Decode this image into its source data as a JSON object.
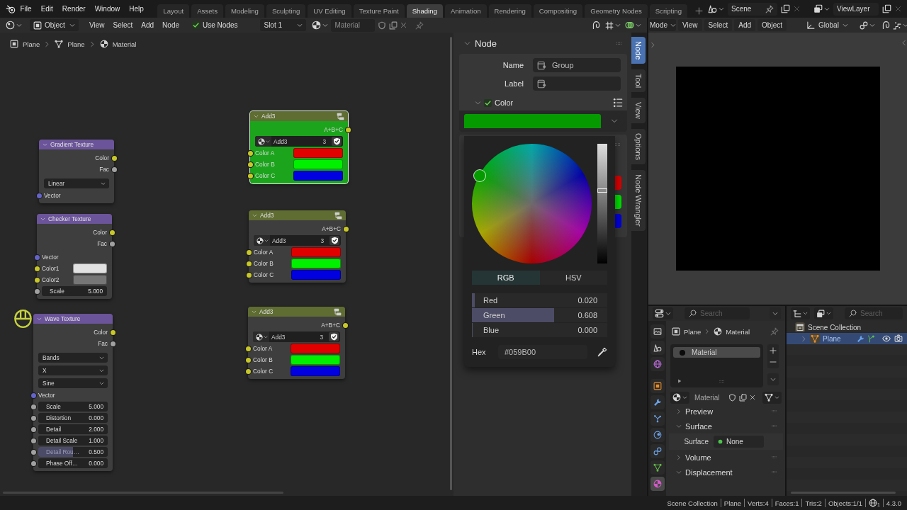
{
  "top_bar": {
    "menus": [
      "File",
      "Edit",
      "Render",
      "Window",
      "Help"
    ],
    "workspaces": [
      {
        "label": "Layout",
        "selected": false
      },
      {
        "label": "Assets",
        "selected": false
      },
      {
        "label": "Modeling",
        "selected": false
      },
      {
        "label": "Sculpting",
        "selected": false
      },
      {
        "label": "UV Editing",
        "selected": false
      },
      {
        "label": "Texture Paint",
        "selected": false
      },
      {
        "label": "Shading",
        "selected": true
      },
      {
        "label": "Animation",
        "selected": false
      },
      {
        "label": "Rendering",
        "selected": false
      },
      {
        "label": "Compositing",
        "selected": false
      },
      {
        "label": "Geometry Nodes",
        "selected": false
      },
      {
        "label": "Scripting",
        "selected": false
      }
    ],
    "scene": "Scene",
    "view_layer": "ViewLayer"
  },
  "node_editor": {
    "header": {
      "shader_type": "Object",
      "menus": [
        "View",
        "Select",
        "Add",
        "Node"
      ],
      "use_nodes": {
        "label": "Use Nodes",
        "checked": true
      },
      "slot": "Slot 1",
      "material": "Material"
    },
    "breadcrumb": [
      {
        "kind": "object",
        "label": "Plane"
      },
      {
        "kind": "mesh",
        "label": "Plane"
      },
      {
        "kind": "material",
        "label": "Material"
      }
    ],
    "nodes": [
      {
        "kind": "texture",
        "title": "Gradient Texture",
        "selected": false,
        "rows": [
          {
            "kind": "output",
            "label": "Color",
            "socket": {
              "kind": "color"
            }
          },
          {
            "kind": "output",
            "label": "Fac",
            "socket": {
              "kind": "float"
            }
          },
          {
            "kind": "menu",
            "value": "Linear"
          },
          {
            "kind": "input",
            "label": "Vector",
            "socket": {
              "kind": "vector"
            }
          }
        ]
      },
      {
        "kind": "texture",
        "title": "Checker Texture",
        "selected": false,
        "rows": [
          {
            "kind": "output",
            "label": "Color",
            "socket": {
              "kind": "color"
            }
          },
          {
            "kind": "output",
            "label": "Fac",
            "socket": {
              "kind": "float"
            }
          },
          {
            "kind": "input",
            "label": "Vector",
            "socket": {
              "kind": "vector"
            }
          },
          {
            "kind": "color",
            "label": "Color1",
            "socket": {
              "kind": "color"
            },
            "color": "#e2e2e2"
          },
          {
            "kind": "color",
            "label": "Color2",
            "socket": {
              "kind": "color"
            },
            "color": "#767676"
          },
          {
            "kind": "number",
            "label": "Scale",
            "value": "5.000",
            "socket": {
              "kind": "float"
            }
          }
        ]
      },
      {
        "kind": "texture",
        "title": "Wave Texture",
        "selected": false,
        "rows": [
          {
            "kind": "output",
            "label": "Color",
            "socket": {
              "kind": "color"
            }
          },
          {
            "kind": "output",
            "label": "Fac",
            "socket": {
              "kind": "float"
            }
          },
          {
            "kind": "menu",
            "value": "Bands"
          },
          {
            "kind": "menu",
            "value": "X"
          },
          {
            "kind": "menu",
            "value": "Sine"
          },
          {
            "kind": "input",
            "label": "Vector",
            "socket": {
              "kind": "vector"
            }
          },
          {
            "kind": "number",
            "label": "Scale",
            "value": "5.000",
            "socket": {
              "kind": "float"
            }
          },
          {
            "kind": "number",
            "label": "Distortion",
            "value": "0.000",
            "socket": {
              "kind": "float"
            }
          },
          {
            "kind": "number",
            "label": "Detail",
            "value": "2.000",
            "socket": {
              "kind": "float"
            }
          },
          {
            "kind": "number",
            "label": "Detail Scale",
            "value": "1.000",
            "socket": {
              "kind": "float"
            }
          },
          {
            "kind": "number",
            "label": "Detail Rou…",
            "value": "0.500",
            "socket": {
              "kind": "float"
            },
            "level": 0.5
          },
          {
            "kind": "number",
            "label": "Phase Off…",
            "value": "0.000",
            "socket": {
              "kind": "float"
            }
          }
        ]
      },
      {
        "kind": "group",
        "title": "Add3",
        "selected": true,
        "color": "#1ca41c",
        "rows": [
          {
            "kind": "output",
            "label": "A+B+C",
            "socket": {
              "kind": "color"
            }
          },
          {
            "kind": "group",
            "name": "Add3",
            "users": "3",
            "fake_user": true
          },
          {
            "kind": "color",
            "label": "Color A",
            "socket": {
              "kind": "color"
            },
            "color": "#e00000"
          },
          {
            "kind": "color",
            "label": "Color B",
            "socket": {
              "kind": "color"
            },
            "color": "#00f000"
          },
          {
            "kind": "color",
            "label": "Color C",
            "socket": {
              "kind": "color"
            },
            "color": "#0000e0"
          }
        ]
      },
      {
        "kind": "group",
        "title": "Add3",
        "selected": false,
        "rows": [
          {
            "kind": "output",
            "label": "A+B+C",
            "socket": {
              "kind": "color"
            }
          },
          {
            "kind": "group",
            "name": "Add3",
            "users": "3",
            "fake_user": true
          },
          {
            "kind": "color",
            "label": "Color A",
            "socket": {
              "kind": "color"
            },
            "color": "#e00000"
          },
          {
            "kind": "color",
            "label": "Color B",
            "socket": {
              "kind": "color"
            },
            "color": "#00f000"
          },
          {
            "kind": "color",
            "label": "Color C",
            "socket": {
              "kind": "color"
            },
            "color": "#0000e0"
          }
        ]
      },
      {
        "kind": "group",
        "title": "Add3",
        "selected": false,
        "rows": [
          {
            "kind": "output",
            "label": "A+B+C",
            "socket": {
              "kind": "color"
            }
          },
          {
            "kind": "group",
            "name": "Add3",
            "users": "3",
            "fake_user": true
          },
          {
            "kind": "color",
            "label": "Color A",
            "socket": {
              "kind": "color"
            },
            "color": "#e00000"
          },
          {
            "kind": "color",
            "label": "Color B",
            "socket": {
              "kind": "color"
            },
            "color": "#00f000"
          },
          {
            "kind": "color",
            "label": "Color C",
            "socket": {
              "kind": "color"
            },
            "color": "#0000e0"
          }
        ]
      }
    ]
  },
  "sidebar": {
    "panel": {
      "title": "Node",
      "expanded": true
    },
    "fields": [
      {
        "label": "Name",
        "value": "Group"
      },
      {
        "label": "Label"
      }
    ],
    "color": {
      "title": "Color",
      "expanded": true,
      "checked": true
    },
    "next_panel": {
      "swatches": [
        {
          "color": "#dd0000"
        },
        {
          "color": "#00e000"
        },
        {
          "color": "#0000dd"
        }
      ]
    }
  },
  "color_picker": {
    "value_slider": {
      "level": 0.608
    },
    "modes": [
      {
        "label": "RGB",
        "selected": true
      },
      {
        "label": "HSV",
        "selected": false
      }
    ],
    "channels": [
      {
        "name": "Red",
        "value": "0.020",
        "level": 0.02
      },
      {
        "name": "Green",
        "value": "0.608",
        "level": 0.608
      },
      {
        "name": "Blue",
        "value": "0.000",
        "level": 0
      }
    ],
    "hex_label": "Hex",
    "hex": "#059B00"
  },
  "sidebar_tabs": [
    {
      "label": "Node",
      "selected": true
    },
    {
      "label": "Tool",
      "selected": false
    },
    {
      "label": "View",
      "selected": false
    },
    {
      "label": "Options",
      "selected": false
    },
    {
      "label": "Node Wrangler",
      "selected": false
    }
  ],
  "viewport": {
    "header": {
      "mode": "Mode",
      "menus": [
        "View",
        "Select",
        "Add",
        "Object"
      ],
      "orientation": "Global"
    }
  },
  "properties": {
    "search": {
      "placeholder": "Search"
    },
    "tabs": [
      {
        "kind": "render",
        "selected": false
      },
      {
        "kind": "scene",
        "selected": false
      },
      {
        "kind": "world",
        "selected": false
      },
      {
        "kind": "object",
        "selected": false
      },
      {
        "kind": "modifiers",
        "selected": false
      },
      {
        "kind": "particles",
        "selected": false
      },
      {
        "kind": "physics",
        "selected": false
      },
      {
        "kind": "constraints",
        "selected": false
      },
      {
        "kind": "data",
        "selected": false
      },
      {
        "kind": "material",
        "selected": true
      }
    ],
    "breadcrumb": [
      {
        "kind": "object",
        "label": "Plane"
      },
      {
        "kind": "material",
        "label": "Material"
      }
    ],
    "slots": [
      {
        "name": "Material",
        "selected": true
      }
    ],
    "material": "Material",
    "panels": [
      {
        "title": "Preview",
        "expanded": false
      },
      {
        "title": "Surface",
        "expanded": true,
        "rows": [
          {
            "label": "Surface",
            "value": "None"
          }
        ]
      },
      {
        "title": "Volume",
        "expanded": false
      },
      {
        "title": "Displacement",
        "expanded": true
      }
    ]
  },
  "outliner": {
    "search": {
      "placeholder": "Search"
    },
    "tree": [
      {
        "kind": "collection",
        "label": "Scene Collection",
        "selected": false,
        "children": [
          {
            "kind": "mesh",
            "label": "Plane",
            "selected": true,
            "expanded": false
          }
        ]
      }
    ]
  },
  "status_bar": {
    "items": [
      "Scene Collection",
      "Plane",
      "Verts:4",
      "Faces:1",
      "Tris:2",
      "Objects:1/1"
    ],
    "globe_count": "1",
    "version": "4.3.0"
  }
}
